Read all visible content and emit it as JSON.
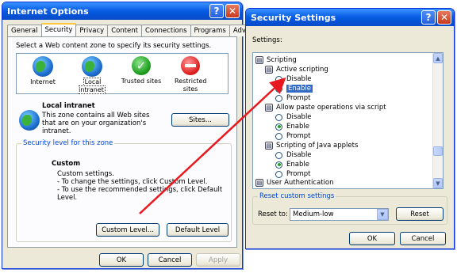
{
  "internet_options": {
    "title": "Internet Options",
    "help_glyph": "?",
    "close_glyph": "✕",
    "tabs": [
      "General",
      "Security",
      "Privacy",
      "Content",
      "Connections",
      "Programs",
      "Advanced"
    ],
    "active_tab": "Security",
    "zone_prompt": "Select a Web content zone to specify its security settings.",
    "zones": [
      {
        "label": "Internet",
        "icon": "globe-icon"
      },
      {
        "label": "Local intranet",
        "icon": "local-intranet-icon"
      },
      {
        "label": "Trusted sites",
        "icon": "trusted-sites-icon"
      },
      {
        "label": "Restricted sites",
        "icon": "restricted-sites-icon"
      }
    ],
    "selected_zone": "Local intranet",
    "zone_title": "Local intranet",
    "zone_desc": "This zone contains all Web sites that are on your organization's intranet.",
    "sites_button": "Sites...",
    "security_level_label": "Security level for this zone",
    "level_name": "Custom",
    "level_lines": [
      "Custom settings.",
      "- To change the settings, click Custom Level.",
      "- To use the recommended settings, click Default Level."
    ],
    "custom_level_button": "Custom Level...",
    "default_level_button": "Default Level",
    "ok_button": "OK",
    "cancel_button": "Cancel",
    "apply_button": "Apply"
  },
  "security_settings": {
    "title": "Security Settings",
    "help_glyph": "?",
    "close_glyph": "✕",
    "settings_label": "Settings:",
    "tree": {
      "root": "Scripting",
      "groups": [
        {
          "name": "Active scripting",
          "options": [
            "Disable",
            "Enable",
            "Prompt"
          ],
          "selected": "Enable"
        },
        {
          "name": "Allow paste operations via script",
          "options": [
            "Disable",
            "Enable",
            "Prompt"
          ],
          "selected": "Enable"
        },
        {
          "name": "Scripting of Java applets",
          "options": [
            "Disable",
            "Enable",
            "Prompt"
          ],
          "selected": "Enable"
        }
      ],
      "partial_item": "User Authentication"
    },
    "reset_group_label": "Reset custom settings",
    "reset_to_label": "Reset to:",
    "reset_to_value": "Medium-low",
    "reset_button": "Reset",
    "ok_button": "OK",
    "cancel_button": "Cancel"
  },
  "colors": {
    "titlebar": "#0a5fe6",
    "dialog_bg": "#ece9d8",
    "selection": "#316ac5",
    "arrow": "#e8181f"
  }
}
